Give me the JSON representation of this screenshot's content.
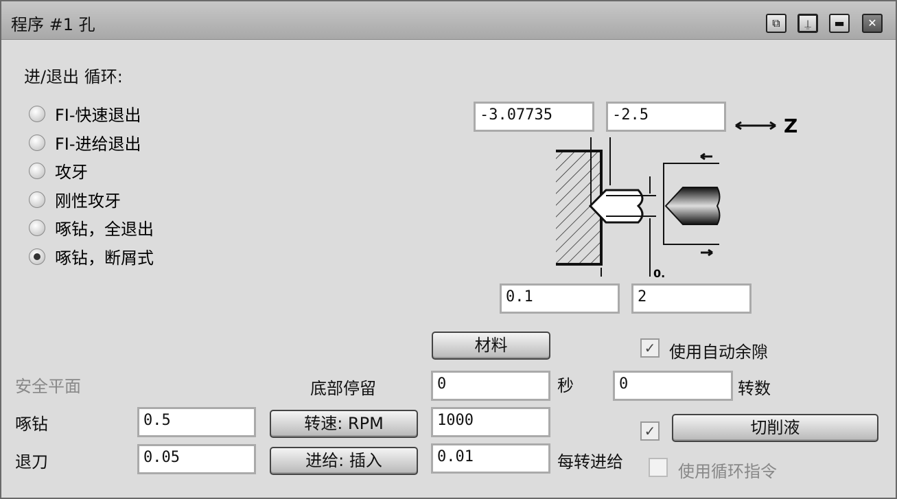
{
  "window": {
    "title": "程序 #1 孔",
    "buttons": [
      "restore-icon",
      "pin-icon",
      "minimize-icon",
      "close-icon"
    ]
  },
  "cycle": {
    "heading": "进/退出 循环:",
    "options": [
      "FI-快速退出",
      "FI-进给退出",
      "攻牙",
      "刚性攻牙",
      "啄钻，全退出",
      "啄钻，断屑式"
    ],
    "selected": 5
  },
  "diagram": {
    "top_left": "-3.07735",
    "top_right": "-2.5",
    "axis": "Z",
    "bottom_left": "0.1",
    "bottom_right": "2",
    "small_label": "0."
  },
  "material_button": "材料",
  "auto_clearance": {
    "label": "使用自动余隙",
    "checked": true
  },
  "safe_plane": "安全平面",
  "dwell": {
    "label": "底部停留",
    "value": "0",
    "seconds_label": "秒",
    "revs_value": "0",
    "revs_label": "转数"
  },
  "peck": {
    "label": "啄钻",
    "value": "0.5"
  },
  "retract": {
    "label": "退刀",
    "value": "0.05"
  },
  "speed": {
    "button": "转速: RPM",
    "value": "1000"
  },
  "feed": {
    "button": "进给: 插入",
    "value": "0.01",
    "unit_label": "每转进给"
  },
  "coolant": {
    "button": "切削液",
    "checked": true
  },
  "canned_cycle": {
    "label": "使用循环指令",
    "checked": false,
    "disabled": true
  }
}
